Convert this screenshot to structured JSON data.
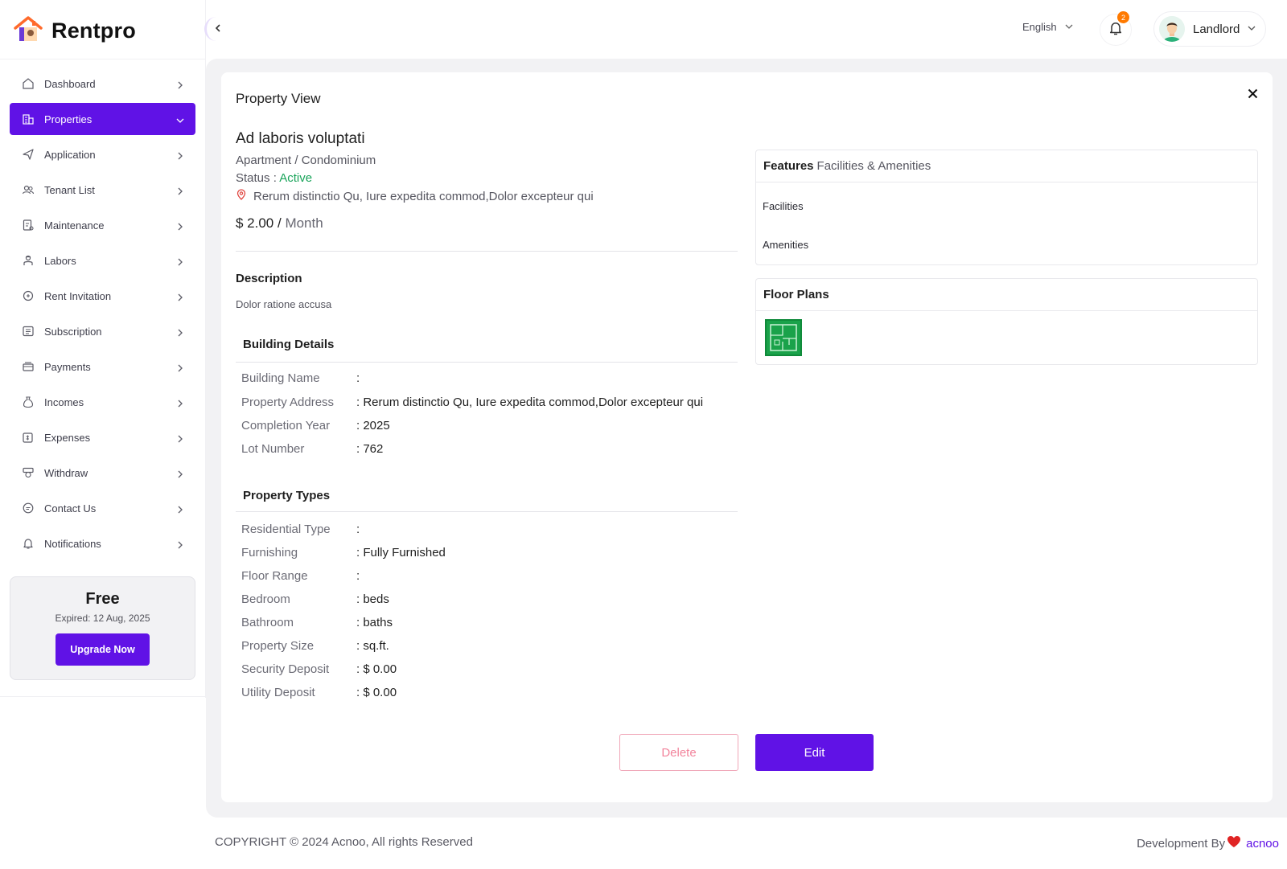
{
  "brand": {
    "name": "Rentpro"
  },
  "sidebar": {
    "items": [
      {
        "label": "Dashboard",
        "icon": "dashboard-icon",
        "active": false
      },
      {
        "label": "Properties",
        "icon": "building-icon",
        "active": true
      },
      {
        "label": "Application",
        "icon": "send-icon",
        "active": false
      },
      {
        "label": "Tenant List",
        "icon": "users-icon",
        "active": false
      },
      {
        "label": "Maintenance",
        "icon": "maintenance-icon",
        "active": false
      },
      {
        "label": "Labors",
        "icon": "worker-icon",
        "active": false
      },
      {
        "label": "Rent Invitation",
        "icon": "invitation-icon",
        "active": false
      },
      {
        "label": "Subscription",
        "icon": "subscription-icon",
        "active": false
      },
      {
        "label": "Payments",
        "icon": "payments-icon",
        "active": false
      },
      {
        "label": "Incomes",
        "icon": "money-bag-icon",
        "active": false
      },
      {
        "label": "Expenses",
        "icon": "expenses-icon",
        "active": false
      },
      {
        "label": "Withdraw",
        "icon": "withdraw-icon",
        "active": false
      },
      {
        "label": "Contact Us",
        "icon": "chat-icon",
        "active": false
      },
      {
        "label": "Notifications",
        "icon": "bell-icon",
        "active": false
      }
    ],
    "plan": {
      "name": "Free",
      "expired": "Expired: 12 Aug, 2025",
      "upgrade_label": "Upgrade Now"
    }
  },
  "header": {
    "language": "English",
    "notification_count": "2",
    "user_role": "Landlord"
  },
  "property": {
    "panel_title": "Property View",
    "name": "Ad laboris voluptati",
    "type": "Apartment / Condominium",
    "status_label": "Status : ",
    "status_value": "Active",
    "address": "Rerum distinctio Qu, Iure expedita commod,Dolor excepteur qui",
    "price": "$ 2.00 / ",
    "price_period": "Month",
    "description_title": "Description",
    "description": "Dolor ratione accusa",
    "building_title": "Building Details",
    "building_rows": [
      {
        "key": "Building Name",
        "value": ":"
      },
      {
        "key": "Property Address",
        "value": ": Rerum distinctio Qu, Iure expedita commod,Dolor excepteur qui"
      },
      {
        "key": "Completion Year",
        "value": ": 2025"
      },
      {
        "key": "Lot Number",
        "value": ": 762"
      }
    ],
    "types_title": "Property Types",
    "type_rows": [
      {
        "key": "Residential Type",
        "value": ":"
      },
      {
        "key": "Furnishing",
        "value": ": Fully Furnished"
      },
      {
        "key": "Floor Range",
        "value": ":"
      },
      {
        "key": "Bedroom",
        "value": ": beds"
      },
      {
        "key": "Bathroom",
        "value": ": baths"
      },
      {
        "key": "Property Size",
        "value": ": sq.ft."
      },
      {
        "key": "Security Deposit",
        "value": ": $ 0.00"
      },
      {
        "key": "Utility Deposit",
        "value": ": $ 0.00"
      }
    ]
  },
  "features": {
    "title_strong": "Features",
    "title_light": "Facilities & Amenities",
    "facilities_label": "Facilities",
    "amenities_label": "Amenities"
  },
  "floor_plans": {
    "title": "Floor Plans"
  },
  "actions": {
    "delete_label": "Delete",
    "edit_label": "Edit"
  },
  "footer": {
    "copyright": "COPYRIGHT © 2024 Acnoo, All rights Reserved",
    "dev_by": "Development By",
    "dev_brand": "acnoo"
  },
  "colors": {
    "accent": "#6012e6",
    "status_active": "#19a45a",
    "badge": "#ff7a00",
    "delete": "#f2849c"
  }
}
